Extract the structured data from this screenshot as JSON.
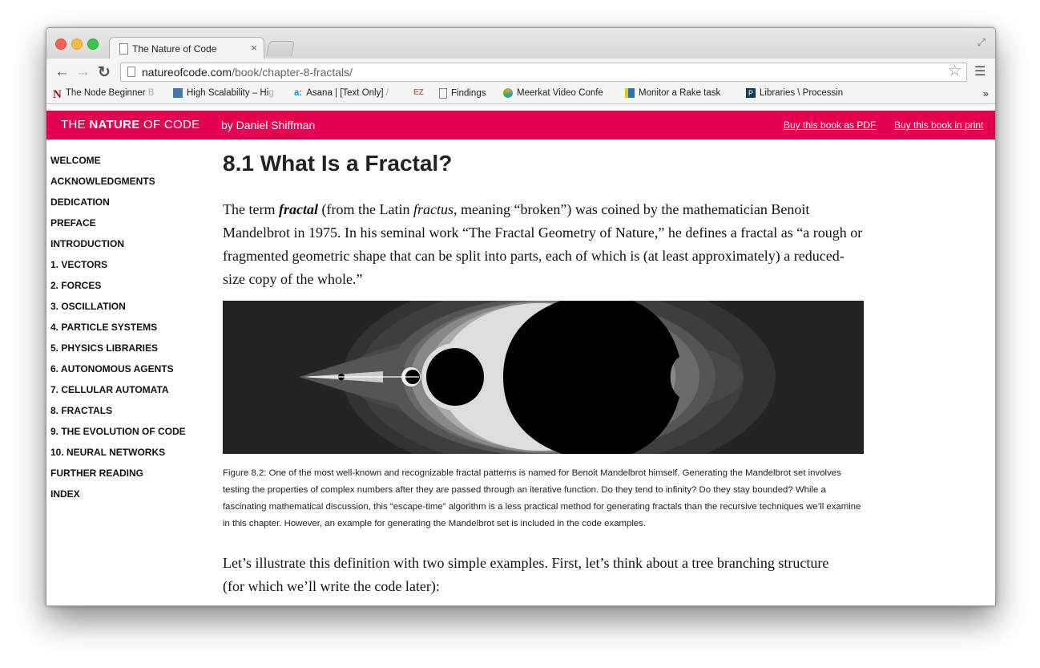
{
  "browser": {
    "tab_title": "The Nature of Code",
    "tab_close": "×",
    "url_host": "natureofcode.com",
    "url_path": "/book/chapter-8-fractals/",
    "bookmarks": [
      {
        "label": "The Node Beginner",
        "fade": " B",
        "icon_color": "#b01010"
      },
      {
        "label": "High Scalability – Hi",
        "fade": "g",
        "icon_color": "#4477aa"
      },
      {
        "label": "Asana | [Text Only] ",
        "fade": "/",
        "icon_color": "#2a9ad8"
      },
      {
        "label": "",
        "fade": "",
        "icon_color": "#d86060"
      },
      {
        "label": "Findings",
        "fade": "",
        "icon_color": "#ffffff"
      },
      {
        "label": "Meerkat Video Confe",
        "fade": "",
        "icon_color": "#e0a020"
      },
      {
        "label": "Monitor a Rake task",
        "fade": "",
        "icon_color": "#2d6fb4"
      },
      {
        "label": "Libraries \\ Processin",
        "fade": "",
        "icon_color": "#1a3a5a"
      }
    ],
    "bookmarks_more": "»"
  },
  "header": {
    "brand_the": "THE ",
    "brand_nature": "NATURE",
    "brand_rest": " OF CODE",
    "byline": "by Daniel Shiffman",
    "buy_pdf": "Buy this book as PDF",
    "buy_print": "Buy this book in print",
    "accent": "#e5004f"
  },
  "sidebar": {
    "items": [
      "WELCOME",
      "ACKNOWLEDGMENTS",
      "DEDICATION",
      "PREFACE",
      "INTRODUCTION",
      "1. VECTORS",
      "2. FORCES",
      "3. OSCILLATION",
      "4. PARTICLE SYSTEMS",
      "5. PHYSICS LIBRARIES",
      "6. AUTONOMOUS AGENTS",
      "7. CELLULAR AUTOMATA",
      "8. FRACTALS",
      "9. THE EVOLUTION OF CODE",
      "10. NEURAL NETWORKS",
      "FURTHER READING",
      "INDEX"
    ]
  },
  "main": {
    "title": "8.1 What Is a Fractal?",
    "para1": {
      "t1": "The term ",
      "t2": "fractal",
      "t3": " (from the Latin ",
      "t4": "fractus",
      "t5": ", meaning “broken”) was coined by the mathematician Benoit Mandelbrot in 1975. In his seminal work “The Fractal Geometry of Nature,” he defines a fractal as “a rough or fragmented geometric shape that can be split into parts, each of which is (at least approximately) a reduced-size copy of the whole.”"
    },
    "caption": "Figure 8.2: One of the most well-known and recognizable fractal patterns is named for Benoit Mandelbrot himself. Generating the Mandelbrot set involves testing the properties of complex numbers after they are passed through an iterative function. Do they tend to infinity? Do they stay bounded? While a fascinating mathematical discussion, this “escape-time” algorithm is a less practical method for generating fractals than the recursive techniques we’ll examine in this chapter. However, an example for generating the Mandelbrot set is included in the code examples.",
    "para2": "Let’s illustrate this definition with two simple examples. First, let’s think about a tree branching structure (for which we’ll write the code later):"
  }
}
